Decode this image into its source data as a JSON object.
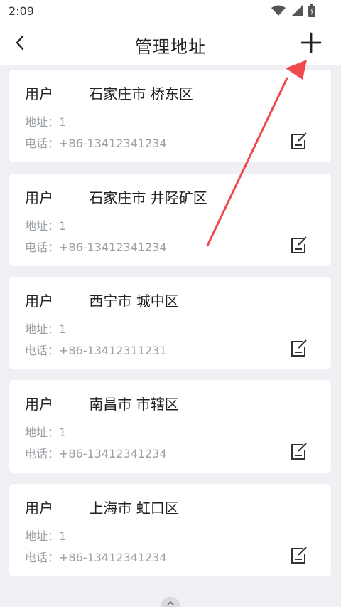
{
  "status_bar": {
    "time": "2:09"
  },
  "header": {
    "title": "管理地址"
  },
  "address_list": [
    {
      "user": "用户",
      "region": "石家庄市 桥东区",
      "address_label": "地址：",
      "address": "1",
      "phone_label": "电话：",
      "phone": "+86-13412341234"
    },
    {
      "user": "用户",
      "region": "石家庄市 井陉矿区",
      "address_label": "地址：",
      "address": "1",
      "phone_label": "电话：",
      "phone": "+86-13412341234"
    },
    {
      "user": "用户",
      "region": "西宁市 城中区",
      "address_label": "地址：",
      "address": "1",
      "phone_label": "电话：",
      "phone": "+86-13412311231"
    },
    {
      "user": "用户",
      "region": "南昌市 市辖区",
      "address_label": "地址：",
      "address": "1",
      "phone_label": "电话：",
      "phone": "+86-13412341234"
    },
    {
      "user": "用户",
      "region": "上海市 虹口区",
      "address_label": "地址：",
      "address": "1",
      "phone_label": "电话：",
      "phone": "+86-13412341234"
    }
  ],
  "colors": {
    "background": "#f0eff4",
    "card": "#ffffff",
    "muted_text": "#9aa0a6",
    "arrow": "#f0484f"
  },
  "icons": {
    "back": "chevron-left-icon",
    "add": "plus-icon",
    "edit": "edit-icon",
    "wifi": "wifi-icon",
    "signal": "signal-icon",
    "battery": "battery-icon",
    "handle": "chevron-up-icon"
  }
}
